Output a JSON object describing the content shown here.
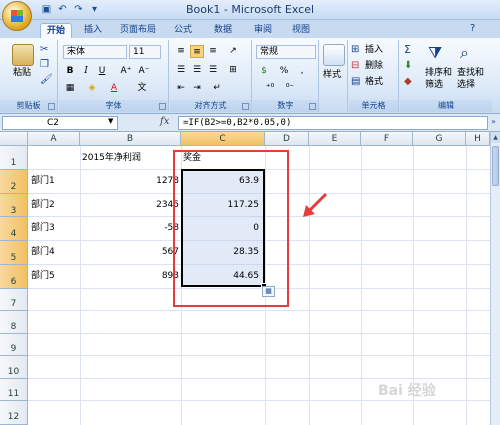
{
  "app": {
    "title": "Book1 - Microsoft Excel"
  },
  "ribbon": {
    "tabs": [
      "开始",
      "插入",
      "页面布局",
      "公式",
      "数据",
      "审阅",
      "视图"
    ],
    "active_tab": "开始",
    "clipboard": {
      "paste_label": "粘贴",
      "group_label": "剪贴板"
    },
    "font": {
      "name": "宋体",
      "size": "11",
      "group_label": "字体",
      "bold": "B",
      "italic": "I",
      "underline": "U",
      "font_color": "A"
    },
    "alignment": {
      "group_label": "对齐方式"
    },
    "number": {
      "format": "常规",
      "percent": "%",
      "comma": ",",
      "group_label": "数字"
    },
    "styles": {
      "label": "样式"
    },
    "cells": {
      "insert": "插入",
      "delete": "删除",
      "format": "格式",
      "group_label": "单元格"
    },
    "editing": {
      "sort_filter": "排序和",
      "sort_filter2": "筛选",
      "find_select": "查找和",
      "find_select2": "选择",
      "group_label": "编辑"
    }
  },
  "formula_bar": {
    "cell_ref": "C2",
    "fx": "fx",
    "formula": "=IF(B2>=0,B2*0.05,0)"
  },
  "sheet": {
    "columns": [
      "A",
      "B",
      "C",
      "D",
      "E",
      "F",
      "G",
      "H"
    ],
    "selected_column": "C",
    "rows": [
      "1",
      "2",
      "3",
      "4",
      "5",
      "6",
      "7",
      "8",
      "9",
      "10",
      "11",
      "12"
    ],
    "cells": {
      "B1": "2015年净利润",
      "C1": "奖金",
      "A2": "部门1",
      "B2": "1278",
      "C2": "63.9",
      "A3": "部门2",
      "B3": "2345",
      "C3": "117.25",
      "A4": "部门3",
      "B4": "-58",
      "C4": "0",
      "A5": "部门4",
      "B5": "567",
      "C5": "28.35",
      "A6": "部门5",
      "B6": "893",
      "C6": "44.65"
    }
  },
  "colors": {
    "annotation": "#e63c3c",
    "selection_fill": "#b0c4e8"
  },
  "watermark": "Bai 经验"
}
